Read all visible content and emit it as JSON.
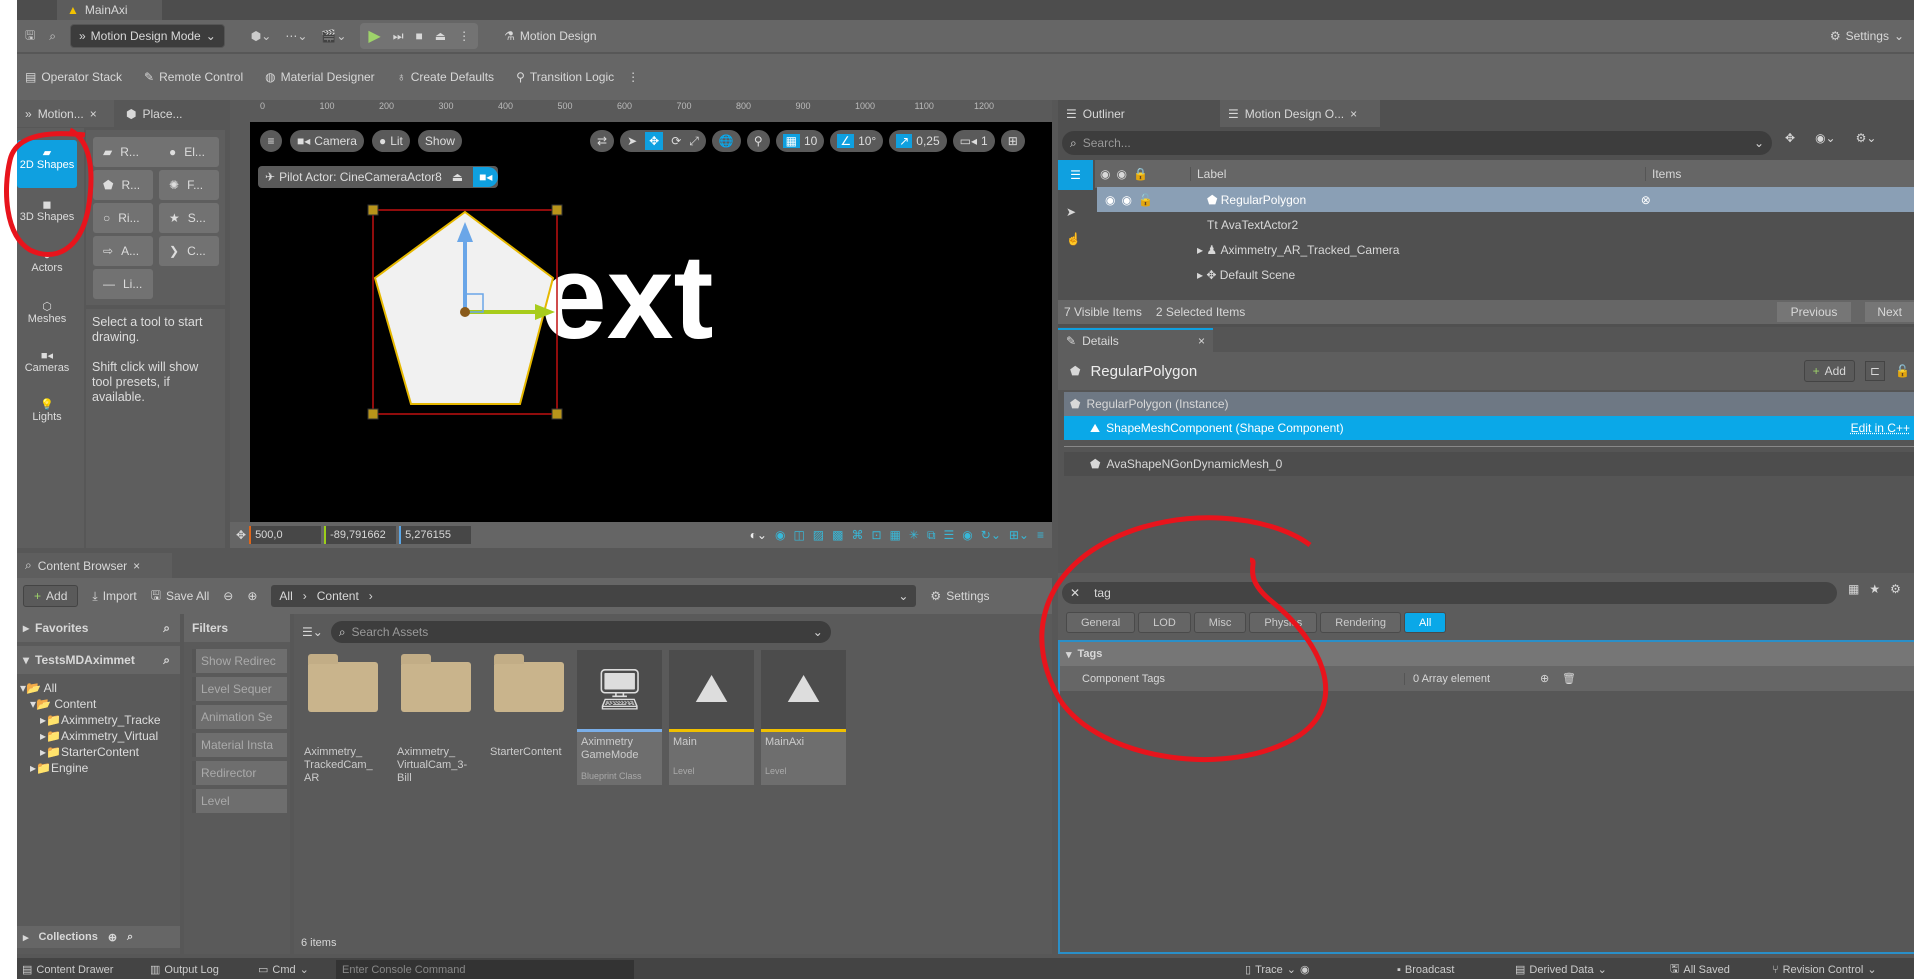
{
  "window": {
    "tab_title": "MainAxi"
  },
  "toolbar": {
    "mode": "Motion Design Mode",
    "motion_design": "Motion Design",
    "settings": "Settings"
  },
  "toolbar2": {
    "items": [
      "Operator Stack",
      "Remote Control",
      "Material Designer",
      "Create Defaults",
      "Transition Logic"
    ]
  },
  "left_tabs": {
    "motion": "Motion...",
    "place": "Place..."
  },
  "modes": [
    "2D Shapes",
    "3D Shapes",
    "Actors",
    "Meshes",
    "Cameras",
    "Lights"
  ],
  "tools": [
    "R...",
    "El...",
    "R...",
    "F...",
    "Ri...",
    "S...",
    "A...",
    "C...",
    "Li..."
  ],
  "tool_hint": {
    "line1": "Select a tool to start drawing.",
    "line2": "Shift click will show tool presets, if available."
  },
  "viewport": {
    "ruler": [
      "0",
      "100",
      "200",
      "300",
      "400",
      "500",
      "600",
      "700",
      "800",
      "900",
      "1000",
      "1100",
      "1200"
    ],
    "camera": "Camera",
    "lit": "Lit",
    "show": "Show",
    "grid": "10",
    "angle": "10°",
    "scale": "0,25",
    "cam_speed": "1",
    "pilot": "Pilot Actor: CineCameraActor8",
    "scene_text": "ext",
    "coords": {
      "x": "500,0",
      "y": "-89,791662",
      "z": "5,276155"
    }
  },
  "outliner": {
    "tabs": [
      "Outliner",
      "Motion Design O..."
    ],
    "search_placeholder": "Search...",
    "columns": {
      "label": "Label",
      "items": "Items"
    },
    "rows": [
      "RegularPolygon",
      "AvaTextActor2",
      "Aximmetry_AR_Tracked_Camera",
      "Default Scene"
    ],
    "visible": "7 Visible Items",
    "selected": "2 Selected Items",
    "previous": "Previous",
    "next": "Next"
  },
  "details": {
    "tab": "Details",
    "title": "RegularPolygon",
    "add": "Add",
    "instance": "RegularPolygon (Instance)",
    "component": "ShapeMeshComponent (Shape Component)",
    "edit_cpp": "Edit in C++",
    "mesh": "AvaShapeNGonDynamicMesh_0",
    "search": "tag",
    "filters": [
      "General",
      "LOD",
      "Misc",
      "Physics",
      "Rendering",
      "All"
    ],
    "section": "Tags",
    "prop": "Component Tags",
    "value": "0 Array element"
  },
  "content_browser": {
    "tab": "Content Browser",
    "add": "Add",
    "import": "Import",
    "save_all": "Save All",
    "path": [
      "All",
      "Content"
    ],
    "settings": "Settings",
    "favorites": "Favorites",
    "project": "TestsMDAximmet",
    "tree": [
      "All",
      "Content",
      "Aximmetry_Tracke",
      "Aximmetry_Virtual",
      "StarterContent",
      "Engine"
    ],
    "filters_title": "Filters",
    "filters": [
      "Show Redirec",
      "Level Sequer",
      "Animation Se",
      "Material Insta",
      "Redirector",
      "Level"
    ],
    "search_placeholder": "Search Assets",
    "assets": [
      {
        "name": "Aximmetry_ TrackedCam_ AR",
        "type": ""
      },
      {
        "name": "Aximmetry_ VirtualCam_3- Bill",
        "type": ""
      },
      {
        "name": "StarterContent",
        "type": ""
      },
      {
        "name": "Aximmetry GameMode",
        "type": "Blueprint Class"
      },
      {
        "name": "Main",
        "type": "Level"
      },
      {
        "name": "MainAxi",
        "type": "Level"
      }
    ],
    "collections": "Collections",
    "count": "6 items"
  },
  "statusbar": {
    "drawer": "Content Drawer",
    "output": "Output Log",
    "cmd": "Cmd",
    "console_placeholder": "Enter Console Command",
    "trace": "Trace",
    "broadcast": "Broadcast",
    "ddc": "Derived Data",
    "saved": "All Saved",
    "rc": "Revision Control"
  },
  "colors": {
    "accent": "#0fa0e0",
    "annotation": "#e8141c",
    "selection": "#8a9fb5"
  }
}
